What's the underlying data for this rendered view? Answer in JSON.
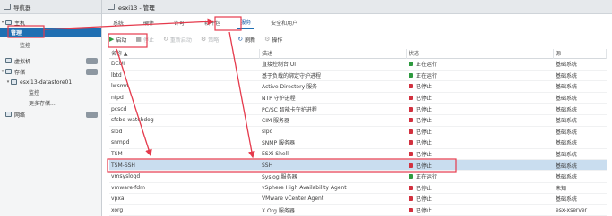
{
  "navigator": {
    "title": "导航器",
    "items": [
      {
        "label": "主机",
        "badge": "",
        "kind": "group"
      },
      {
        "label": "管理",
        "badge": "",
        "kind": "selected"
      },
      {
        "label": "监控",
        "badge": "",
        "kind": "child"
      },
      {
        "label": "虚拟机",
        "badge": "",
        "kind": "group"
      },
      {
        "label": "存储",
        "badge": "",
        "kind": "group"
      },
      {
        "label": "esxi13-datastore01",
        "badge": "",
        "kind": "child"
      },
      {
        "label": "监控",
        "badge": "",
        "kind": "subchild"
      },
      {
        "label": "更多存储...",
        "badge": "",
        "kind": "subchild"
      },
      {
        "label": "网络",
        "badge": "",
        "kind": "group"
      }
    ]
  },
  "header": {
    "title": "esxi13 - 管理"
  },
  "tabs": [
    "系统",
    "硬件",
    "许可",
    "软件包",
    "服务",
    "安全和用户"
  ],
  "active_tab": "服务",
  "toolbar": {
    "start": "启动",
    "stop": "停止",
    "restart": "重新启动",
    "policy": "策略",
    "refresh": "刷新",
    "actions": "操作"
  },
  "table": {
    "columns": [
      "名称 ▲",
      "描述",
      "状态",
      "源"
    ],
    "rows": [
      {
        "name": "DCUI",
        "desc": "直接控制台 UI",
        "status": "正在运行",
        "source": "基础系统",
        "running": true
      },
      {
        "name": "lbtd",
        "desc": "基于负载的绑定守护进程",
        "status": "正在运行",
        "source": "基础系统",
        "running": true
      },
      {
        "name": "lwsmd",
        "desc": "Active Directory 服务",
        "status": "已停止",
        "source": "基础系统",
        "running": false
      },
      {
        "name": "ntpd",
        "desc": "NTP 守护进程",
        "status": "已停止",
        "source": "基础系统",
        "running": false
      },
      {
        "name": "pcscd",
        "desc": "PC/SC 智能卡守护进程",
        "status": "已停止",
        "source": "基础系统",
        "running": false
      },
      {
        "name": "sfcbd-watchdog",
        "desc": "CIM 服务器",
        "status": "已停止",
        "source": "基础系统",
        "running": false
      },
      {
        "name": "slpd",
        "desc": "slpd",
        "status": "已停止",
        "source": "基础系统",
        "running": false
      },
      {
        "name": "snmpd",
        "desc": "SNMP 服务器",
        "status": "已停止",
        "source": "基础系统",
        "running": false
      },
      {
        "name": "TSM",
        "desc": "ESXi Shell",
        "status": "已停止",
        "source": "基础系统",
        "running": false
      },
      {
        "name": "TSM-SSH",
        "desc": "SSH",
        "status": "已停止",
        "source": "基础系统",
        "running": false,
        "highlight": true
      },
      {
        "name": "vmsyslogd",
        "desc": "Syslog 服务器",
        "status": "正在运行",
        "source": "基础系统",
        "running": true
      },
      {
        "name": "vmware-fdm",
        "desc": "vSphere High Availability Agent",
        "status": "已停止",
        "source": "未知",
        "running": false
      },
      {
        "name": "vpxa",
        "desc": "VMware vCenter Agent",
        "status": "已停止",
        "source": "基础系统",
        "running": false
      },
      {
        "name": "xorg",
        "desc": "X.Org 服务器",
        "status": "已停止",
        "source": "esx-xserver",
        "running": false
      }
    ]
  },
  "colors": {
    "accent": "#1f6fb2",
    "running": "#2e9a3f",
    "stopped": "#d2313f",
    "annotation": "#e53a4c",
    "highlight_row": "#c9ddef"
  }
}
